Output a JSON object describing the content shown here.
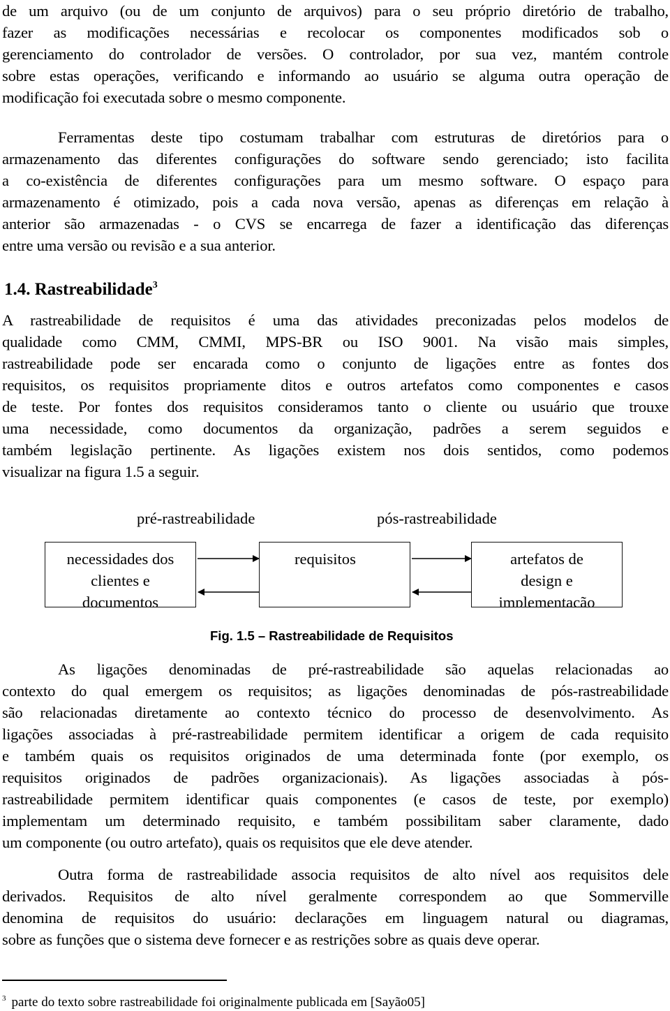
{
  "paragraphs": {
    "p1": {
      "lines": [
        "de um arquivo (ou de um conjunto de arquivos) para o seu próprio diretório de trabalho,",
        "fazer as modificações necessárias e recolocar os componentes modificados sob o",
        "gerenciamento do controlador de versões. O controlador, por sua vez, mantém controle",
        "sobre estas operações, verificando e informando ao usuário se alguma outra operação de",
        "modificação foi executada sobre o mesmo componente."
      ]
    },
    "p2": {
      "lines": [
        "Ferramentas deste tipo costumam trabalhar com estruturas de diretórios para o",
        "armazenamento das diferentes configurações do software sendo gerenciado; isto facilita",
        "a co-existência de diferentes configurações para um mesmo software. O espaço para",
        "armazenamento é otimizado, pois a cada nova versão, apenas as diferenças em relação à",
        "anterior são armazenadas - o CVS se encarrega de fazer a identificação das diferenças",
        "entre uma versão ou revisão e a sua anterior."
      ]
    },
    "p3": {
      "lines": [
        "A rastreabilidade de requisitos é uma das atividades preconizadas pelos modelos de",
        "qualidade como CMM, CMMI, MPS-BR ou ISO 9001. Na visão mais simples,",
        "rastreabilidade pode ser encarada como o conjunto de ligações entre as fontes dos",
        "requisitos, os requisitos propriamente ditos e outros artefatos como componentes e casos",
        "de teste. Por fontes dos requisitos consideramos tanto o cliente ou usuário que trouxe",
        "uma necessidade, como documentos da organização, padrões a serem seguidos e",
        "também legislação pertinente. As ligações existem nos dois sentidos, como podemos",
        "visualizar na figura 1.5 a seguir."
      ]
    },
    "p4": {
      "lines": [
        "As ligações denominadas de pré-rastreabilidade são aquelas relacionadas ao",
        "contexto do qual emergem os requisitos; as ligações denominadas de pós-rastreabilidade",
        "são relacionadas diretamente ao contexto técnico do processo de desenvolvimento. As",
        "ligações associadas à pré-rastreabilidade permitem identificar a origem de cada requisito",
        "e também quais os requisitos originados de uma determinada fonte (por exemplo, os",
        "requisitos originados de padrões organizacionais).  As ligações associadas à pós-",
        "rastreabilidade permitem identificar quais componentes (e casos de teste, por exemplo)",
        "implementam um determinado requisito, e também possibilitam saber claramente, dado",
        "um componente (ou outro artefato), quais os requisitos que ele deve atender."
      ]
    },
    "p5": {
      "lines": [
        "Outra forma de rastreabilidade associa requisitos de alto nível aos requisitos dele",
        "derivados. Requisitos de alto nível geralmente correspondem ao que Sommerville",
        "denomina de requisitos do usuário: declarações em linguagem natural ou diagramas,",
        "sobre as funções que o sistema deve fornecer e as restrições sobre as quais deve operar."
      ]
    }
  },
  "heading": {
    "number_title": "1.4. Rastreabilidade",
    "footnote_ref": "3"
  },
  "figure": {
    "label_pre": "pré-rastreabilidade",
    "label_pos": "pós-rastreabilidade",
    "boxes": [
      {
        "lines": [
          "necessidades dos",
          "clientes e",
          "documentos"
        ]
      },
      {
        "lines": [
          "requisitos"
        ]
      },
      {
        "lines": [
          "artefatos de",
          "design e",
          "implementação"
        ]
      }
    ],
    "caption": "Fig. 1.5 – Rastreabilidade de Requisitos"
  },
  "footnote": {
    "marker": "3",
    "text": "parte do texto sobre rastreabilidade foi originalmente publicada em [Sayão05]"
  }
}
